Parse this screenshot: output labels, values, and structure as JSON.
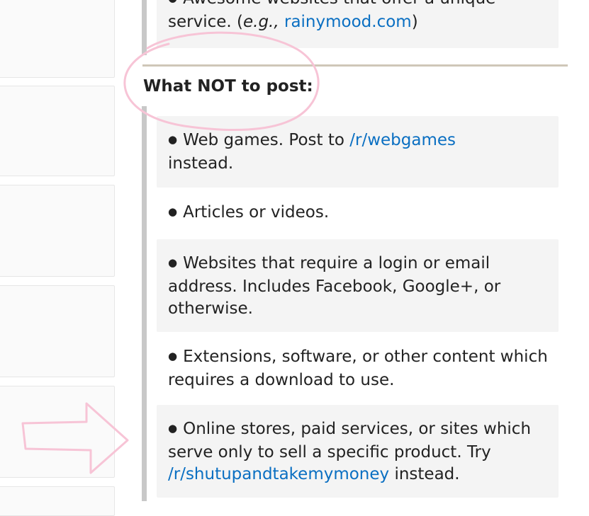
{
  "sidebar": {
    "top_item": {
      "line1": "Awesome websites that offer a unique",
      "line2_pre": "service. (",
      "line2_em": "e.g.,",
      "link": "rainymood.com",
      "line2_post": ")"
    },
    "heading": "What NOT to post:",
    "rules": [
      {
        "pre": "Web games. Post to ",
        "link": "/r/webgames",
        "post": "instead."
      },
      {
        "pre": "Articles or videos.",
        "link": "",
        "post": ""
      },
      {
        "pre": "Websites that require a login or email address. Includes Facebook, Google+, or otherwise.",
        "link": "",
        "post": ""
      },
      {
        "pre": "Extensions, software, or other content which requires a download to use.",
        "link": "",
        "post": ""
      },
      {
        "pre": "Online stores, paid services, or sites which serve only to sell a specific product. Try ",
        "link": "/r/shutupandtakemymoney",
        "post": " instead."
      }
    ],
    "bullet_glyph": "●"
  },
  "colors": {
    "link": "#0a6fc2",
    "rule_box": "#f4f4f4",
    "quote_bar": "#c8c8c8",
    "divider": "#cfc7b8",
    "annotation": "#f7c4d6"
  }
}
